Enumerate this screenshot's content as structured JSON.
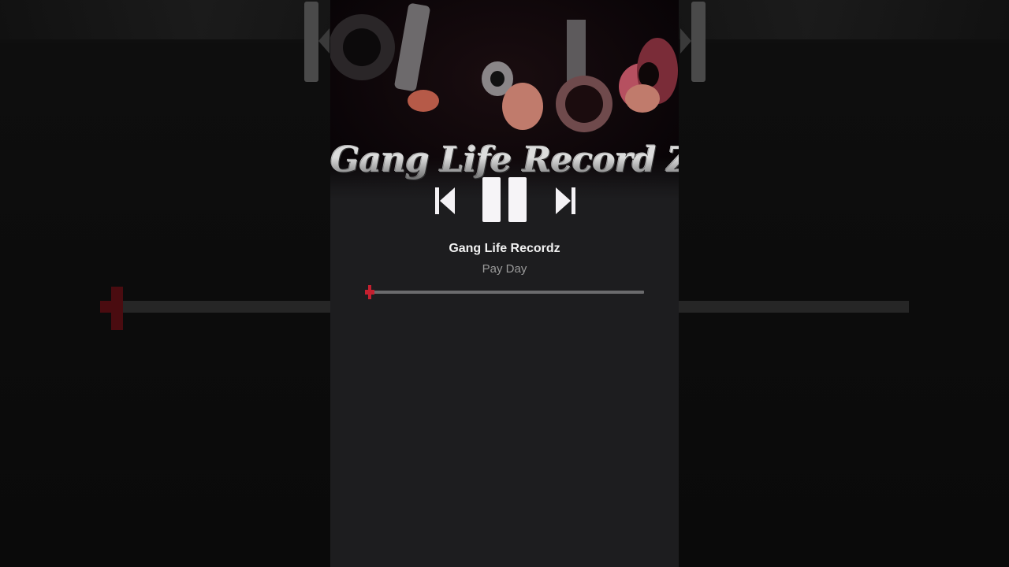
{
  "album_art": {
    "logo_text": "Gang Life Record Z",
    "description_icon": "album-artwork"
  },
  "player": {
    "artist": "Gang Life Recordz",
    "track": "Pay Day",
    "progress_fraction": 0.01,
    "state": "playing"
  },
  "controls": {
    "previous_icon": "skip-previous-icon",
    "pause_icon": "pause-icon",
    "next_icon": "skip-next-icon"
  },
  "colors": {
    "accent": "#c4202f",
    "panel_bg": "#1d1d1f",
    "page_bg": "#080808",
    "track_bg": "#6b6b6d",
    "primary_text": "#f1f1f1",
    "secondary_text": "#9b9b9b"
  }
}
